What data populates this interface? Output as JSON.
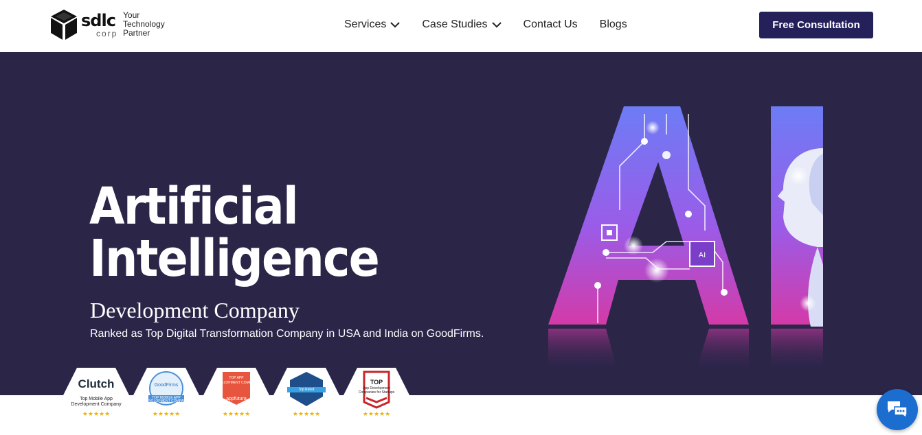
{
  "header": {
    "logo": {
      "word": "sdlc",
      "corp": "corp",
      "tagline": "Your Technology Partner"
    },
    "nav": [
      {
        "label": "Services",
        "has_dropdown": true
      },
      {
        "label": "Case Studies",
        "has_dropdown": true
      },
      {
        "label": "Contact Us",
        "has_dropdown": false
      },
      {
        "label": "Blogs",
        "has_dropdown": false
      }
    ],
    "cta_label": "Free Consultation"
  },
  "hero": {
    "title_line1": "Artificial",
    "title_line2": "Intelligence",
    "subtitle": "Development Company",
    "description": "Ranked as Top Digital Transformation Company in USA and India on GoodFirms.",
    "art_chip_label": "AI"
  },
  "badges": [
    {
      "name": "Clutch",
      "line1": "Top Mobile App",
      "line2": "Development Company",
      "stars": "★★★★★"
    },
    {
      "name": "GoodFirms",
      "line1": "TOP MOBILE APP",
      "line2": "DEVELOPMENT COMPANY",
      "stars": "★★★★★"
    },
    {
      "name": "appfutura",
      "line1": "TOP APP",
      "line2": "DEVELOPMENT COMPANY",
      "stars": "★★★★★"
    },
    {
      "name": "Top Rated",
      "line1": "",
      "line2": "",
      "stars": "★★★★★"
    },
    {
      "name": "TOP",
      "line1": "App Development",
      "line2": "Companies for Startups",
      "stars": "★★★★★"
    }
  ],
  "colors": {
    "brand_navy": "#24205a",
    "hero_bg": "#2b2548",
    "chat_blue": "#1c6dd0",
    "star_gold": "#f0b400"
  },
  "icons": [
    "logo-cube-icon",
    "chevron-down-icon",
    "chat-icon"
  ]
}
